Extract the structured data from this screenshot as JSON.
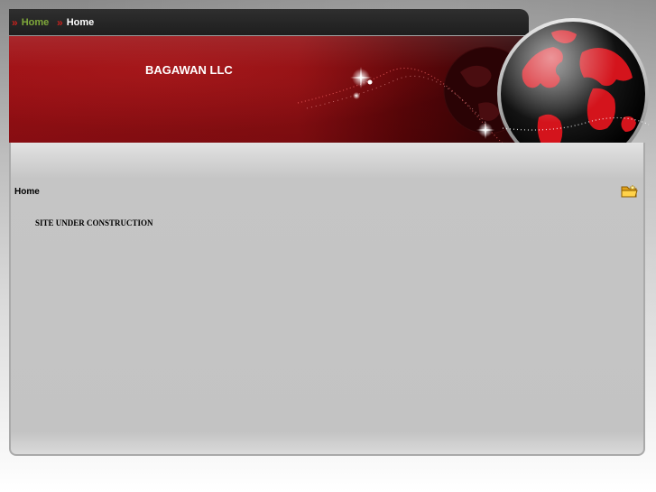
{
  "nav": {
    "items": [
      {
        "label": "Home"
      },
      {
        "label": "Home"
      }
    ]
  },
  "banner": {
    "title": "BAGAWAN LLC"
  },
  "content": {
    "heading": "Home",
    "body_text": "SITE UNDER CONSTRUCTION"
  },
  "icons": {
    "nav_bullet": "double-chevron-right-icon",
    "corner": "folder-icon",
    "logo": "globe-icon"
  },
  "colors": {
    "banner_red": "#9a0f14",
    "nav_dark": "#1e1e1e",
    "nav_active_green": "#7fa83a",
    "nav_chevron_red": "#c4221e",
    "panel_gray": "#c3c3c3"
  }
}
